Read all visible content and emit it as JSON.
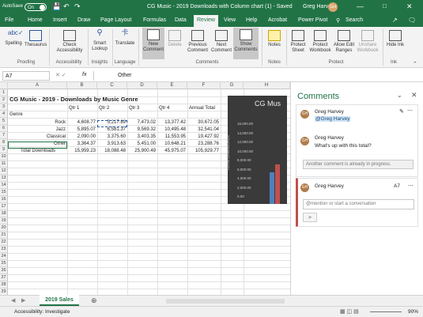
{
  "titlebar": {
    "autosave_label": "AutoSave",
    "autosave_state": "On",
    "title": "CG Music - 2019 Downloads with Column chart (1) - Saved",
    "user": "Greg Harvey",
    "avatar_initials": "GH"
  },
  "menu": {
    "tabs": [
      "File",
      "Home",
      "Insert",
      "Draw",
      "Page Layout",
      "Formulas",
      "Data",
      "Review",
      "View",
      "Help",
      "Acrobat",
      "Power Pivot"
    ],
    "active": "Review",
    "search_placeholder": "Search"
  },
  "ribbon": {
    "proofing": {
      "spelling": "Spelling",
      "thesaurus": "Thesaurus",
      "group": "Proofing"
    },
    "accessibility": {
      "check": "Check Accessibility",
      "group": "Accessibility"
    },
    "insights": {
      "smart_lookup": "Smart Lookup",
      "group": "Insights"
    },
    "language": {
      "translate": "Translate",
      "group": "Language"
    },
    "comments": {
      "new": "New Comment",
      "delete": "Delete",
      "previous": "Previous Comment",
      "next": "Next Comment",
      "show": "Show Comments",
      "group": "Comments"
    },
    "notes": {
      "label": "Notes",
      "group": "Notes"
    },
    "protect": {
      "sheet": "Protect Sheet",
      "workbook": "Protect Workbook",
      "allow_edit": "Allow Edit Ranges",
      "unshare": "Unshare Workbook",
      "group": "Protect"
    },
    "ink": {
      "hide": "Hide Ink",
      "group": "Ink"
    }
  },
  "formula_bar": {
    "name_box": "A7",
    "fx": "fx",
    "value": "Other"
  },
  "sheet": {
    "columns": [
      "A",
      "B",
      "C",
      "D",
      "E",
      "F",
      "G",
      "H"
    ],
    "rows": [
      "1",
      "2",
      "3",
      "4",
      "5",
      "6",
      "7",
      "8",
      "9",
      "10",
      "11",
      "12",
      "13",
      "14",
      "15",
      "16",
      "17",
      "18",
      "19",
      "20",
      "21",
      "22",
      "23",
      "24",
      "25",
      "26",
      "27",
      "28",
      "29",
      "30"
    ],
    "title": "CG Music - 2019 - Downloads by Music Genre",
    "headers": [
      "Qtr 1",
      "Qtr 2",
      "Qtr 3",
      "Qtr 4",
      "Annual Total"
    ],
    "genre_label": "Genre",
    "data": [
      {
        "genre": "Rock",
        "values": [
          "4,608.77",
          "5,217.89",
          "7,473.02",
          "13,377.42",
          "30,672.05"
        ]
      },
      {
        "genre": "Jazz",
        "values": [
          "5,895.07",
          "6,581.37",
          "9,569.32",
          "10,495.48",
          "32,541.04"
        ]
      },
      {
        "genre": "Classical",
        "values": [
          "2,090.00",
          "3,375.60",
          "3,403.35",
          "11,553.95",
          "19,427.92"
        ]
      },
      {
        "genre": "Other",
        "values": [
          "3,364.37",
          "3,913.63",
          "5,451.00",
          "10,648.21",
          "23,288.76"
        ]
      }
    ],
    "total_label": "Total Downloads",
    "totals": [
      "15,959.23",
      "18,088.48",
      "25,900.49",
      "45,975.07",
      "105,929.77"
    ]
  },
  "chart": {
    "title": "CG Mus",
    "axis_label": "TOTAL DOWNLOADS",
    "ticks": [
      "16,000.00",
      "14,000.00",
      "12,000.00",
      "10,000.00",
      "8,000.00",
      "6,000.00",
      "4,000.00",
      "2,000.00",
      "0.00"
    ]
  },
  "comments_pane": {
    "title": "Comments",
    "thread1": {
      "author": "Greg Harvey",
      "mention": "@Greg Harvey",
      "reply_author": "Greg Harvey",
      "reply_text": "What's up with this total?",
      "status": "Another comment is already in progress."
    },
    "thread2": {
      "author": "Greg Harvey",
      "cell": "A7",
      "placeholder": "@mention or start a conversation"
    }
  },
  "sheet_tab": "2019 Sales",
  "status": {
    "accessibility": "Accessibility: Investigate",
    "zoom": "90%"
  },
  "colors": {
    "excel_green": "#217346",
    "chart_bg": "#3a3a3a",
    "comment_accent": "#c0504d"
  }
}
